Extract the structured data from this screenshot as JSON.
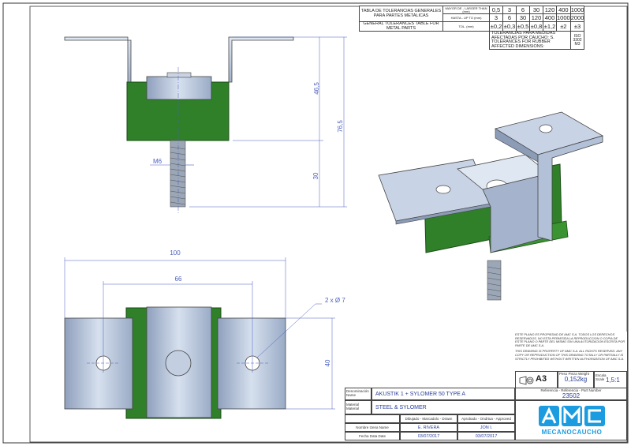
{
  "tolerances": {
    "title_es": "TABLA DE TOLERANCIAS GENERALES PARA PARTES METALICAS",
    "title_en": "GENERAL TOLERANCES TABLE FOR METAL PARTS",
    "row1_label": "MAYOR DE - LARGER THAN (mm)",
    "row2_label": "HASTA - UP TO (mm)",
    "row3_label": "TOL. (mm)",
    "larger_than": [
      "0,5",
      "3",
      "6",
      "30",
      "120",
      "400",
      "1000"
    ],
    "up_to": [
      "3",
      "6",
      "30",
      "120",
      "400",
      "1000",
      "2000"
    ],
    "tol": [
      "±0,2",
      "±0,3",
      "±0,5",
      "±0,8",
      "±1,2",
      "±2",
      "±3"
    ],
    "rubber_es": "TOLERANCIAS PARA MEDIDAS AFECTADAS POR CAUCHO: S.",
    "rubber_en": "TOLERANCES FOR RUBBER AFFECTED DIMENSIONS:",
    "rubber_std": "ISO 3302 M3"
  },
  "dims": {
    "h1": "46,5",
    "h2": "76,5",
    "h3": "30",
    "thread": "M6",
    "w_total": "100",
    "w_holes": "66",
    "holes": "2 x Ø 7",
    "depth": "40"
  },
  "notice": {
    "es": "ESTE PLANO ES PROPIEDAD DE AMC S.A. TODOS LOS DERECHOS RESERVADOS. NO ESTA PERMITIDA LA REPRODUCCION O COPIA DE ESTE PLANO O PARTE DEL MISMO SIN UNA AUTORIZACION ESCRITA POR PARTE DE AMC S.A.",
    "en": "THIS DRAWING IS PROPERTY OF AMC S.A. ALL RIGHTS RESERVED. ANY COPY OR REPRODUCTION OF THIS DRAWING TOTALLY OR PARTIALLY IS STRICTLY PROHIBITED WITHOUT WRITTEN AUTHORIZATION OF AMC S.A."
  },
  "titleblock": {
    "sheet_size": "A3",
    "weight_label": "Peso Pieza Weight",
    "weight": "0,152kg",
    "scale_label": "Escala Scale",
    "scale": "1,5:1",
    "ref_label": "Referencia - Referencia - Part Number",
    "ref": "23502",
    "name_label": "Denominación Name",
    "name": "AKUSTIK 1 + SYLOMER 50 TYPE A",
    "material_label": "Material Material",
    "material": "STEEL & SYLOMER",
    "drawn_label": "Dibujado - Marcadolo - Drawn",
    "approved_label": "Aprobado - Ondrtua - Approved",
    "names_label": "Nombre Izena Name",
    "drawn_by": "E. RIVERA",
    "approved_by": "JON I.",
    "date_label": "Fecha Data Date",
    "drawn_date": "03/07/2017",
    "approved_date": "03/07/2017",
    "logo_text": "AMC",
    "logo_sub": "MECANOCAUCHO"
  },
  "colors": {
    "steel": "#b8c6dc",
    "rubber": "#2e7d27",
    "dim": "#4a5fbf",
    "logo": "#1b9be0"
  }
}
